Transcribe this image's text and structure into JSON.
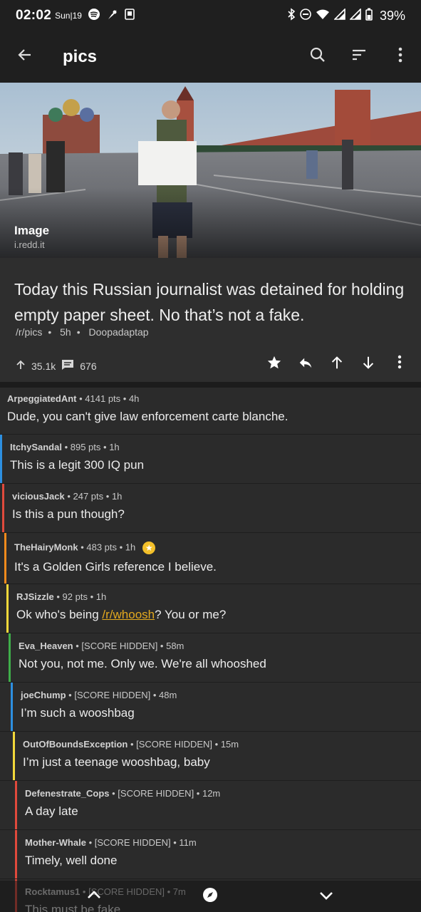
{
  "status_bar": {
    "time": "02:02",
    "date": "Sun|19",
    "battery": "39%",
    "icons": [
      "spotify-icon",
      "pinwheel-icon",
      "screenshot-icon",
      "bluetooth-icon",
      "dnd-icon",
      "wifi-icon",
      "signal-icon",
      "signal-icon",
      "battery-icon"
    ]
  },
  "app_bar": {
    "title": "pics",
    "icons": [
      "back-arrow-icon",
      "search-icon",
      "sort-icon",
      "more-vert-icon"
    ]
  },
  "hero": {
    "label": "Image",
    "source": "i.redd.it"
  },
  "post": {
    "title": "Today this Russian journalist was detained for holding empty paper sheet. No that’s not a fake.",
    "subreddit": "/r/pics",
    "age": "5h",
    "author": "Doopadaptap",
    "score": "35.1k",
    "comments": "676",
    "actions": [
      "star-icon",
      "reply-icon",
      "upvote-icon",
      "downvote-icon",
      "more-vert-icon"
    ]
  },
  "comments": [
    {
      "author": "ArpeggiatedAnt",
      "score": "4141 pts",
      "age": "4h",
      "body": "Dude, you can't give law enforcement carte blanche.",
      "depth": 0,
      "color": ""
    },
    {
      "author": "ItchySandal",
      "score": "895 pts",
      "age": "1h",
      "body": "This is a legit 300 IQ pun",
      "depth": 1,
      "color": "#2d8fe0"
    },
    {
      "author": "viciousJack",
      "score": "247 pts",
      "age": "1h",
      "body": "Is this a pun though?",
      "depth": 2,
      "color": "#e04a3c"
    },
    {
      "author": "TheHairyMonk",
      "score": "483 pts",
      "age": "1h",
      "body": "It's a Golden Girls reference I believe.",
      "depth": 3,
      "color": "#f08a1c",
      "award": true
    },
    {
      "author": "RJSizzle",
      "score": "92 pts",
      "age": "1h",
      "body_before": "Ok who's being ",
      "body_link": "/r/whoosh",
      "body_after": "? You or me?",
      "depth": 4,
      "color": "#f2d83a"
    },
    {
      "author": "Eva_Heaven",
      "score": "[SCORE HIDDEN]",
      "age": "58m",
      "body": "Not you, not me. Only we. We're all whooshed",
      "depth": 5,
      "color": "#3fae4a"
    },
    {
      "author": "joeChump",
      "score": "[SCORE HIDDEN]",
      "age": "48m",
      "body": "I’m such a wooshbag",
      "depth": 6,
      "color": "#2d8fe0"
    },
    {
      "author": "OutOfBoundsException",
      "score": "[SCORE HIDDEN]",
      "age": "15m",
      "body": "I’m just a teenage wooshbag, baby",
      "depth": 7,
      "color": "#f2d83a"
    },
    {
      "author": "Defenestrate_Cops",
      "score": "[SCORE HIDDEN]",
      "age": "12m",
      "body": "A day late",
      "depth": 8,
      "color": "#e04a3c"
    },
    {
      "author": "Mother-Whale",
      "score": "[SCORE HIDDEN]",
      "age": "11m",
      "body": "Timely, well done",
      "depth": 8,
      "color": "#e04a3c"
    },
    {
      "author": "Rocktamus1",
      "score": "[SCORE HIDDEN]",
      "age": "7m",
      "body": "This must be fake",
      "depth": 8,
      "color": "#e04a3c"
    }
  ],
  "bottom_nav": {
    "icons": [
      "chevron-up-icon",
      "compass-icon",
      "chevron-down-icon"
    ]
  }
}
